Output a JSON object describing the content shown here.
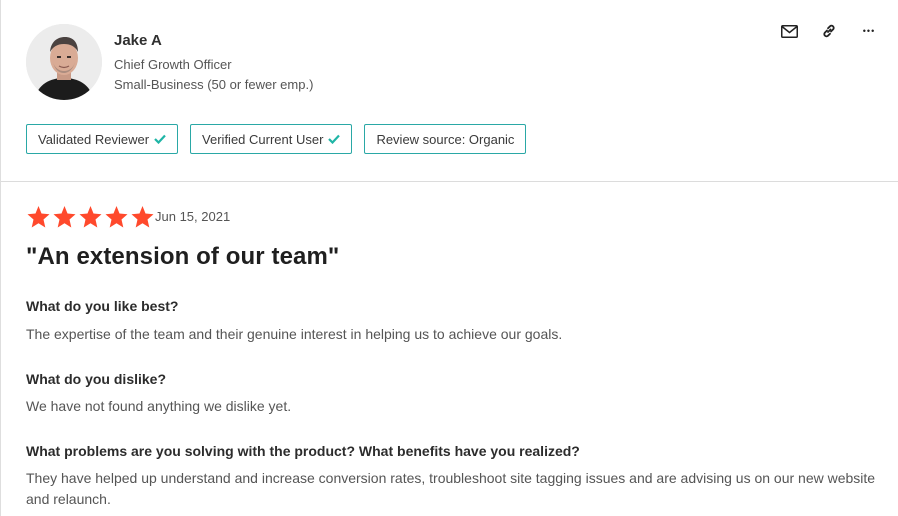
{
  "reviewer": {
    "name": "Jake A",
    "title": "Chief Growth Officer",
    "company_size": "Small-Business (50 or fewer emp.)"
  },
  "actions": {
    "icons": [
      "mail-icon",
      "link-icon",
      "more-icon"
    ],
    "more_glyph": "•••"
  },
  "badges": [
    {
      "label": "Validated Reviewer",
      "checked": true
    },
    {
      "label": "Verified Current User",
      "checked": true
    },
    {
      "label": "Review source: Organic",
      "checked": false
    }
  ],
  "review": {
    "rating": 5,
    "rating_max": 5,
    "date": "Jun 15, 2021",
    "headline": "\"An extension of our team\"",
    "qa": [
      {
        "question": "What do you like best?",
        "answer": "The expertise of the team and their genuine interest in helping us to achieve our goals."
      },
      {
        "question": "What do you dislike?",
        "answer": "We have not found anything we dislike yet."
      },
      {
        "question": "What problems are you solving with the product? What benefits have you realized?",
        "answer": "They have helped up understand and increase conversion rates, troubleshoot site tagging issues and are advising us on our new website and relaunch."
      }
    ]
  },
  "colors": {
    "star": "#ff492c",
    "badge_border": "#2aa8a6",
    "check": "#1fb5a6"
  }
}
